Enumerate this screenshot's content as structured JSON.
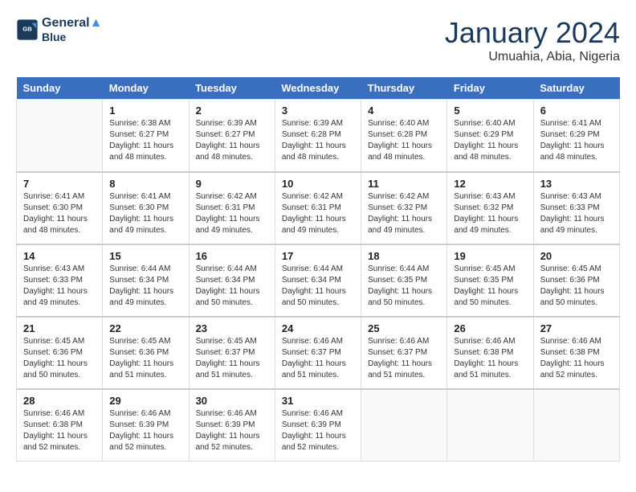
{
  "header": {
    "logo_line1": "General",
    "logo_line2": "Blue",
    "month": "January 2024",
    "location": "Umuahia, Abia, Nigeria"
  },
  "weekdays": [
    "Sunday",
    "Monday",
    "Tuesday",
    "Wednesday",
    "Thursday",
    "Friday",
    "Saturday"
  ],
  "weeks": [
    [
      {
        "day": "",
        "info": ""
      },
      {
        "day": "1",
        "info": "Sunrise: 6:38 AM\nSunset: 6:27 PM\nDaylight: 11 hours\nand 48 minutes."
      },
      {
        "day": "2",
        "info": "Sunrise: 6:39 AM\nSunset: 6:27 PM\nDaylight: 11 hours\nand 48 minutes."
      },
      {
        "day": "3",
        "info": "Sunrise: 6:39 AM\nSunset: 6:28 PM\nDaylight: 11 hours\nand 48 minutes."
      },
      {
        "day": "4",
        "info": "Sunrise: 6:40 AM\nSunset: 6:28 PM\nDaylight: 11 hours\nand 48 minutes."
      },
      {
        "day": "5",
        "info": "Sunrise: 6:40 AM\nSunset: 6:29 PM\nDaylight: 11 hours\nand 48 minutes."
      },
      {
        "day": "6",
        "info": "Sunrise: 6:41 AM\nSunset: 6:29 PM\nDaylight: 11 hours\nand 48 minutes."
      }
    ],
    [
      {
        "day": "7",
        "info": "Sunrise: 6:41 AM\nSunset: 6:30 PM\nDaylight: 11 hours\nand 48 minutes."
      },
      {
        "day": "8",
        "info": "Sunrise: 6:41 AM\nSunset: 6:30 PM\nDaylight: 11 hours\nand 49 minutes."
      },
      {
        "day": "9",
        "info": "Sunrise: 6:42 AM\nSunset: 6:31 PM\nDaylight: 11 hours\nand 49 minutes."
      },
      {
        "day": "10",
        "info": "Sunrise: 6:42 AM\nSunset: 6:31 PM\nDaylight: 11 hours\nand 49 minutes."
      },
      {
        "day": "11",
        "info": "Sunrise: 6:42 AM\nSunset: 6:32 PM\nDaylight: 11 hours\nand 49 minutes."
      },
      {
        "day": "12",
        "info": "Sunrise: 6:43 AM\nSunset: 6:32 PM\nDaylight: 11 hours\nand 49 minutes."
      },
      {
        "day": "13",
        "info": "Sunrise: 6:43 AM\nSunset: 6:33 PM\nDaylight: 11 hours\nand 49 minutes."
      }
    ],
    [
      {
        "day": "14",
        "info": "Sunrise: 6:43 AM\nSunset: 6:33 PM\nDaylight: 11 hours\nand 49 minutes."
      },
      {
        "day": "15",
        "info": "Sunrise: 6:44 AM\nSunset: 6:34 PM\nDaylight: 11 hours\nand 49 minutes."
      },
      {
        "day": "16",
        "info": "Sunrise: 6:44 AM\nSunset: 6:34 PM\nDaylight: 11 hours\nand 50 minutes."
      },
      {
        "day": "17",
        "info": "Sunrise: 6:44 AM\nSunset: 6:34 PM\nDaylight: 11 hours\nand 50 minutes."
      },
      {
        "day": "18",
        "info": "Sunrise: 6:44 AM\nSunset: 6:35 PM\nDaylight: 11 hours\nand 50 minutes."
      },
      {
        "day": "19",
        "info": "Sunrise: 6:45 AM\nSunset: 6:35 PM\nDaylight: 11 hours\nand 50 minutes."
      },
      {
        "day": "20",
        "info": "Sunrise: 6:45 AM\nSunset: 6:36 PM\nDaylight: 11 hours\nand 50 minutes."
      }
    ],
    [
      {
        "day": "21",
        "info": "Sunrise: 6:45 AM\nSunset: 6:36 PM\nDaylight: 11 hours\nand 50 minutes."
      },
      {
        "day": "22",
        "info": "Sunrise: 6:45 AM\nSunset: 6:36 PM\nDaylight: 11 hours\nand 51 minutes."
      },
      {
        "day": "23",
        "info": "Sunrise: 6:45 AM\nSunset: 6:37 PM\nDaylight: 11 hours\nand 51 minutes."
      },
      {
        "day": "24",
        "info": "Sunrise: 6:46 AM\nSunset: 6:37 PM\nDaylight: 11 hours\nand 51 minutes."
      },
      {
        "day": "25",
        "info": "Sunrise: 6:46 AM\nSunset: 6:37 PM\nDaylight: 11 hours\nand 51 minutes."
      },
      {
        "day": "26",
        "info": "Sunrise: 6:46 AM\nSunset: 6:38 PM\nDaylight: 11 hours\nand 51 minutes."
      },
      {
        "day": "27",
        "info": "Sunrise: 6:46 AM\nSunset: 6:38 PM\nDaylight: 11 hours\nand 52 minutes."
      }
    ],
    [
      {
        "day": "28",
        "info": "Sunrise: 6:46 AM\nSunset: 6:38 PM\nDaylight: 11 hours\nand 52 minutes."
      },
      {
        "day": "29",
        "info": "Sunrise: 6:46 AM\nSunset: 6:39 PM\nDaylight: 11 hours\nand 52 minutes."
      },
      {
        "day": "30",
        "info": "Sunrise: 6:46 AM\nSunset: 6:39 PM\nDaylight: 11 hours\nand 52 minutes."
      },
      {
        "day": "31",
        "info": "Sunrise: 6:46 AM\nSunset: 6:39 PM\nDaylight: 11 hours\nand 52 minutes."
      },
      {
        "day": "",
        "info": ""
      },
      {
        "day": "",
        "info": ""
      },
      {
        "day": "",
        "info": ""
      }
    ]
  ]
}
